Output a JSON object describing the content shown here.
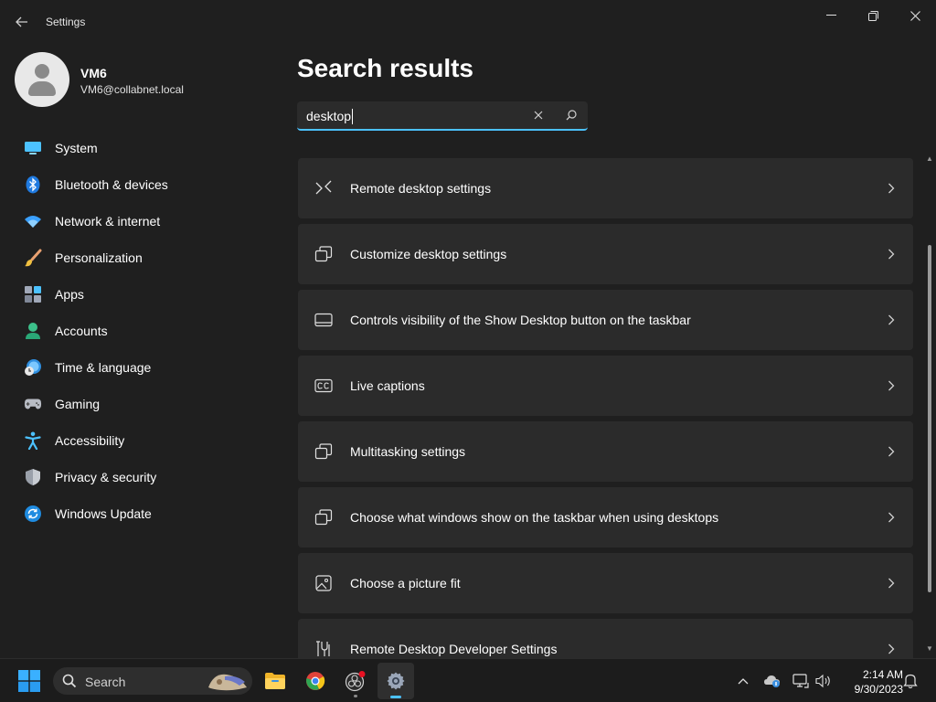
{
  "window": {
    "app_title": "Settings",
    "back_icon": "back-arrow-icon",
    "minimize_icon": "minimize-icon",
    "maximize_icon": "restore-icon",
    "close_icon": "close-icon"
  },
  "profile": {
    "name": "VM6",
    "email": "VM6@collabnet.local"
  },
  "sidebar": {
    "items": [
      {
        "label": "System",
        "icon": "system-icon"
      },
      {
        "label": "Bluetooth & devices",
        "icon": "bluetooth-icon"
      },
      {
        "label": "Network & internet",
        "icon": "wifi-icon"
      },
      {
        "label": "Personalization",
        "icon": "brush-icon"
      },
      {
        "label": "Apps",
        "icon": "apps-icon"
      },
      {
        "label": "Accounts",
        "icon": "accounts-icon"
      },
      {
        "label": "Time & language",
        "icon": "clock-globe-icon"
      },
      {
        "label": "Gaming",
        "icon": "gamepad-icon"
      },
      {
        "label": "Accessibility",
        "icon": "accessibility-icon"
      },
      {
        "label": "Privacy & security",
        "icon": "shield-icon"
      },
      {
        "label": "Windows Update",
        "icon": "update-icon"
      }
    ]
  },
  "main": {
    "title": "Search results",
    "search": {
      "value": "desktop",
      "clear_icon": "clear-icon",
      "search_icon": "search-icon"
    },
    "results": [
      {
        "label": "Remote desktop settings",
        "icon": "remote-desktop-icon"
      },
      {
        "label": "Customize desktop settings",
        "icon": "multiwindow-icon"
      },
      {
        "label": "Controls visibility of the Show Desktop button on the taskbar",
        "icon": "taskbar-icon"
      },
      {
        "label": "Live captions",
        "icon": "cc-icon"
      },
      {
        "label": "Multitasking settings",
        "icon": "multiwindow-icon"
      },
      {
        "label": "Choose what windows show on the taskbar when using desktops",
        "icon": "multiwindow-icon"
      },
      {
        "label": "Choose a picture fit",
        "icon": "picture-icon"
      },
      {
        "label": "Remote Desktop Developer Settings",
        "icon": "developer-tools-icon"
      }
    ]
  },
  "taskbar": {
    "search_label": "Search",
    "apps": [
      "file-explorer-icon",
      "chrome-icon",
      "obs-icon",
      "settings-gear-icon"
    ],
    "tray": [
      "chevron-up-icon",
      "onedrive-icon",
      "network-icon",
      "volume-icon"
    ],
    "time": "2:14 AM",
    "date": "9/30/2023",
    "notification_icon": "bell-icon"
  },
  "colors": {
    "background": "#1f1f1f",
    "card": "#2b2b2b",
    "accent": "#4cc2ff"
  }
}
